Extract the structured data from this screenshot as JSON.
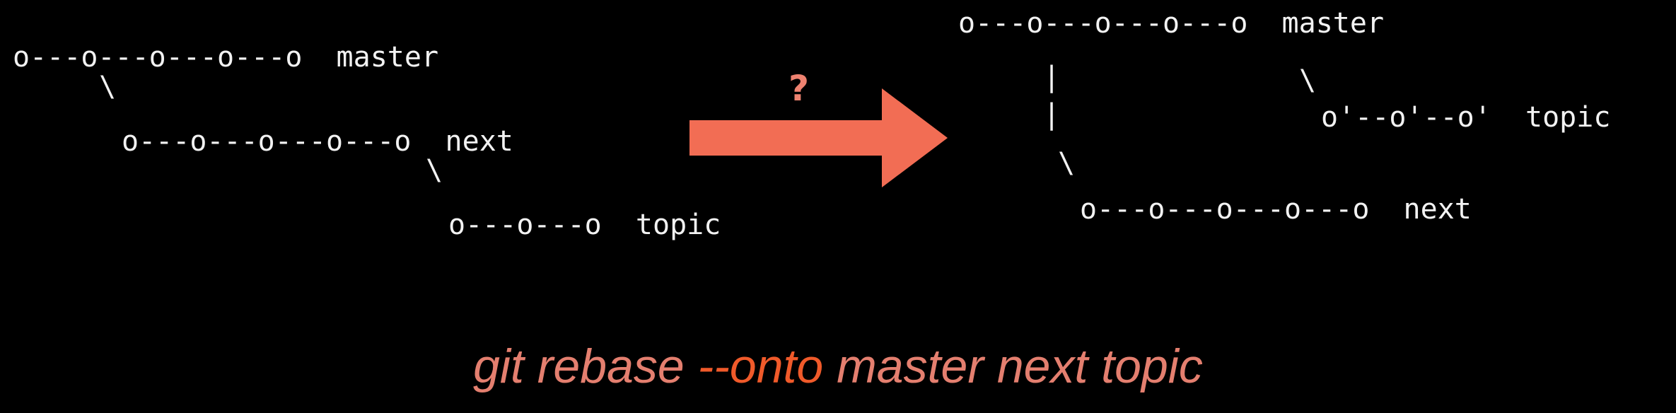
{
  "before": {
    "master_line": "o---o---o---o---o  master",
    "master_branch": "\\",
    "next_line": "o---o---o---o---o  next",
    "next_branch": "\\",
    "topic_line": "o---o---o  topic"
  },
  "question_mark": "?",
  "after": {
    "master_line": "o---o---o---o---o  master",
    "pipe_1": "|",
    "master_branch": "\\",
    "pipe_2": "|",
    "topic_line": "o'--o'--o'  topic",
    "next_branch": "\\",
    "next_line": "o---o---o---o---o  next"
  },
  "command": {
    "prefix": "git rebase ",
    "option": "--onto",
    "args": " master next topic"
  },
  "colors": {
    "background": "#000000",
    "text": "#f2f2f2",
    "arrow": "#f26d54",
    "command": "#e47f6f",
    "option": "#f05a2a"
  }
}
